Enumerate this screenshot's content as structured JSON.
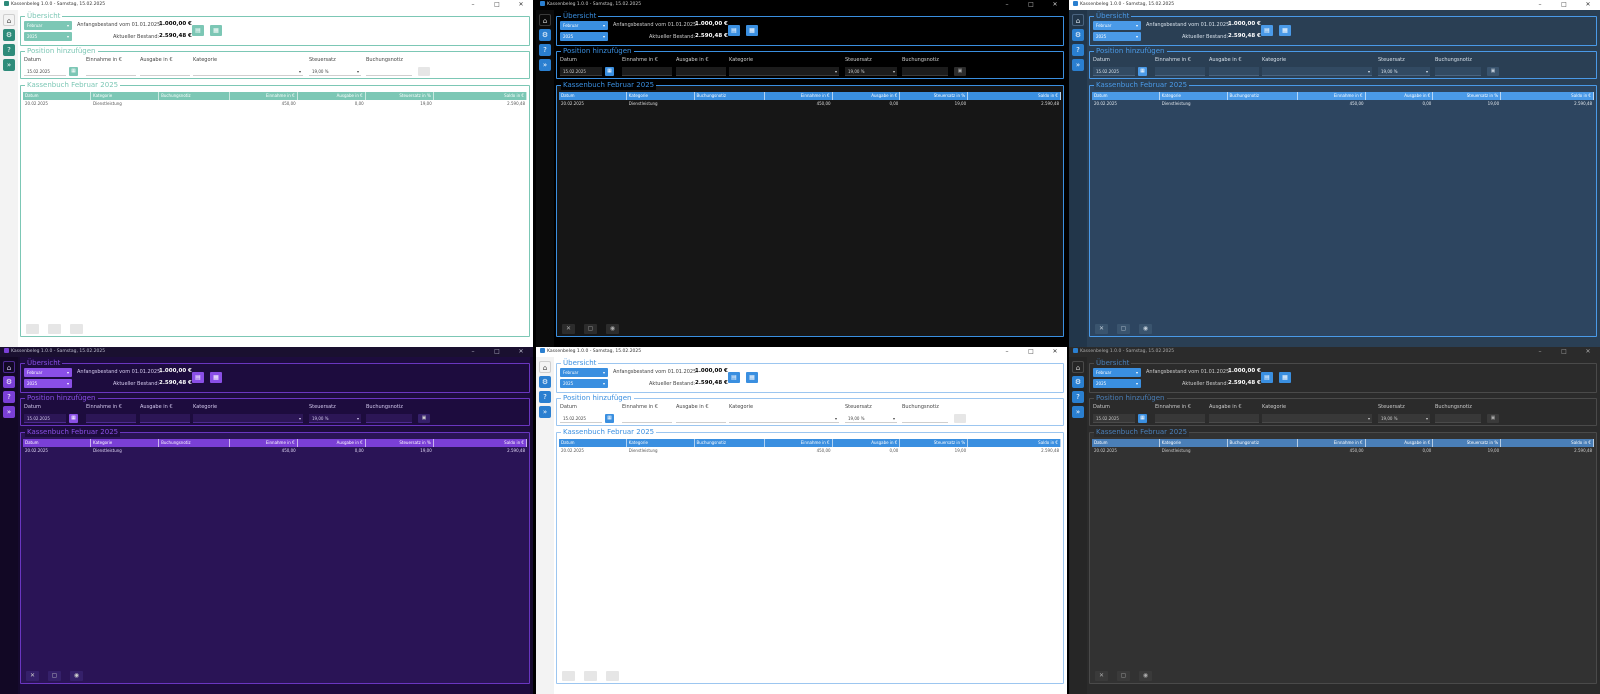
{
  "windows": [
    {
      "title": "Kassenbeleg 1.0.0 - Samstag, 15.02.2025",
      "theme": {
        "win": "#ffffff",
        "main": "#ffffff",
        "title": "#ffffff",
        "titleText": "#333333",
        "side": "#f3f3f3",
        "sbtn": "#2e8b7a",
        "sbtnText": "#ffffff",
        "accent": "#7cc7b5",
        "fsBorder": "#7cc7b5",
        "legend": "#7cc7b5",
        "text": "#444444",
        "valText": "#000000",
        "inpBg": "#ffffff",
        "inpBorder": "#cfcfcf",
        "selBg": "#7cc7b5",
        "selText": "#ffffff",
        "btnBg": "#7cc7b5",
        "btnText": "#ffffff",
        "headBg": "#7cc7b5",
        "headText": "#ffffff",
        "tableBg": "#ffffff",
        "rowText": "#555555",
        "footBtn": "#e6e6e6",
        "footText": "#e6e6e6"
      }
    },
    {
      "title": "Kassenbeleg 1.0.0 - Samstag, 15.02.2025",
      "theme": {
        "win": "#000000",
        "main": "#000000",
        "title": "#000000",
        "titleText": "#cccccc",
        "side": "#0a0a0a",
        "sbtn": "#2a7fd0",
        "sbtnText": "#ffffff",
        "accent": "#3a8fe0",
        "fsBorder": "#3a8fe0",
        "legend": "#3a8fe0",
        "text": "#cfcfcf",
        "valText": "#ffffff",
        "inpBg": "#1c1c1c",
        "inpBorder": "#3a3a3a",
        "selBg": "#3a8fe0",
        "selText": "#ffffff",
        "btnBg": "#3a8fe0",
        "btnText": "#ffffff",
        "headBg": "#3a8fe0",
        "headText": "#ffffff",
        "tableBg": "#161616",
        "rowText": "#dddddd",
        "footBtn": "#2c2c2c",
        "footText": "#aaaaaa"
      }
    },
    {
      "title": "Kassenbeleg 1.0.0 - Samstag, 15.02.2025",
      "theme": {
        "win": "#2a3f54",
        "main": "#2a3f54",
        "title": "#ffffff",
        "titleText": "#333333",
        "side": "#22364a",
        "sbtn": "#2a7fd0",
        "sbtnText": "#ffffff",
        "accent": "#4a9ae8",
        "fsBorder": "#4a9ae8",
        "legend": "#4a9ae8",
        "text": "#d8e2ec",
        "valText": "#ffffff",
        "inpBg": "#324a62",
        "inpBorder": "#4a6480",
        "selBg": "#4a9ae8",
        "selText": "#ffffff",
        "btnBg": "#4a9ae8",
        "btnText": "#ffffff",
        "headBg": "#4a9ae8",
        "headText": "#ffffff",
        "tableBg": "#2d4560",
        "rowText": "#e2e8ee",
        "footBtn": "#3a546e",
        "footText": "#c0ccd8"
      }
    },
    {
      "title": "Kassenbeleg 1.0.0 - Samstag, 15.02.2025",
      "theme": {
        "win": "#160a2e",
        "main": "#1d0c3e",
        "title": "#1a1030",
        "titleText": "#bbbbcc",
        "side": "#120825",
        "sbtn": "#7a3fd6",
        "sbtnText": "#ffffff",
        "accent": "#8a4fe6",
        "fsBorder": "#6a36c0",
        "legend": "#8a4fe6",
        "text": "#d6ccf0",
        "valText": "#ffffff",
        "inpBg": "#2c1656",
        "inpBorder": "#4d2a90",
        "selBg": "#8a4fe6",
        "selText": "#ffffff",
        "btnBg": "#8a4fe6",
        "btnText": "#ffffff",
        "headBg": "#7a3fd6",
        "headText": "#ffffff",
        "tableBg": "#2a1456",
        "rowText": "#e0d6f6",
        "footBtn": "#35206a",
        "footText": "#cccccc"
      }
    },
    {
      "title": "Kassenbeleg 1.0.0 - Samstag, 15.02.2025",
      "theme": {
        "win": "#ffffff",
        "main": "#ffffff",
        "title": "#ffffff",
        "titleText": "#333333",
        "side": "#f3f3f3",
        "sbtn": "#2a7fd0",
        "sbtnText": "#ffffff",
        "accent": "#3a8fe0",
        "fsBorder": "#9cc6f0",
        "legend": "#3a8fe0",
        "text": "#444444",
        "valText": "#000000",
        "inpBg": "#ffffff",
        "inpBorder": "#cfcfcf",
        "selBg": "#3a8fe0",
        "selText": "#ffffff",
        "btnBg": "#3a8fe0",
        "btnText": "#ffffff",
        "headBg": "#3a8fe0",
        "headText": "#ffffff",
        "tableBg": "#ffffff",
        "rowText": "#555555",
        "footBtn": "#e6e6e6",
        "footText": "#e6e6e6"
      }
    },
    {
      "title": "Kassenbeleg 1.0.0 - Samstag, 15.02.2025",
      "theme": {
        "win": "#2b2b2b",
        "main": "#2b2b2b",
        "title": "#2b2b2b",
        "titleText": "#aaaaaa",
        "side": "#262626",
        "sbtn": "#2a7fd0",
        "sbtnText": "#ffffff",
        "accent": "#4a7fb8",
        "fsBorder": "#4a4a4a",
        "legend": "#4a7fb8",
        "text": "#cccccc",
        "valText": "#ffffff",
        "inpBg": "#383838",
        "inpBorder": "#4a4a4a",
        "selBg": "#3a8fe0",
        "selText": "#ffffff",
        "btnBg": "#3a8fe0",
        "btnText": "#ffffff",
        "headBg": "#4a7fb8",
        "headText": "#ffffff",
        "tableBg": "#323232",
        "rowText": "#cccccc",
        "footBtn": "#3a3a3a",
        "footText": "#aaaaaa"
      }
    }
  ],
  "app": {
    "overview_legend": "Übersicht",
    "month_value": "Februar",
    "year_value": "2025",
    "opening_balance_label": "Anfangsbestand vom 01.01.2025:",
    "opening_balance_value": "1.000,00 €",
    "current_balance_label": "Aktueller Bestand:",
    "current_balance_value": "2.590,48 €",
    "add_legend": "Position hinzufügen",
    "label_date": "Datum",
    "label_income": "Einnahme in €",
    "label_expense": "Ausgabe in €",
    "label_category": "Kategorie",
    "label_tax": "Steuersatz",
    "label_note": "Buchungsnotiz",
    "date_value": "15.02.2025",
    "tax_value": "19,00 %",
    "table_legend": "Kassenbuch Februar 2025",
    "columns": [
      "Datum",
      "Kategorie",
      "Buchungsnotiz",
      "Einnahme in €",
      "Ausgabe in €",
      "Steuersatz in %",
      "Saldo in €"
    ],
    "rows": [
      [
        "20.02.2025",
        "Dienstleistung",
        "",
        "450,00",
        "0,00",
        "19,00",
        "2.590,48"
      ]
    ]
  },
  "icons": {
    "nav": [
      "home-icon",
      "settings-icon",
      "help-icon",
      "expand-icon"
    ],
    "actions": [
      "document-icon",
      "calendar-icon"
    ],
    "footer": [
      "delete-icon",
      "file-icon",
      "view-icon"
    ],
    "save": "save-icon"
  }
}
